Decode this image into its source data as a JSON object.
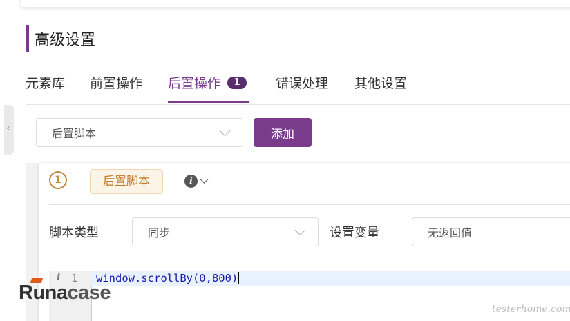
{
  "section": {
    "title": "高级设置"
  },
  "tabs": [
    {
      "label": "元素库"
    },
    {
      "label": "前置操作"
    },
    {
      "label": "后置操作",
      "badge": "1",
      "active": true
    },
    {
      "label": "错误处理"
    },
    {
      "label": "其他设置"
    }
  ],
  "toolbar": {
    "script_type_select": "后置脚本",
    "add_label": "添加"
  },
  "script_card": {
    "index": "1",
    "tag": "后置脚本",
    "info_icon": "i",
    "fields": {
      "script_type_label": "脚本类型",
      "script_type_value": "同步",
      "set_var_label": "设置变量",
      "set_var_value": "无返回值"
    },
    "editor": {
      "line_number": "1",
      "line_icon": "i",
      "code": "window.scrollBy(0,800)"
    }
  },
  "branding": {
    "logo_text_a": "Runa",
    "logo_text_b": "case",
    "watermark": "testerhome.com"
  },
  "colors": {
    "accent": "#7a3b8c",
    "tag_bg": "#fdf4e8",
    "tag_text": "#c07b2a"
  }
}
